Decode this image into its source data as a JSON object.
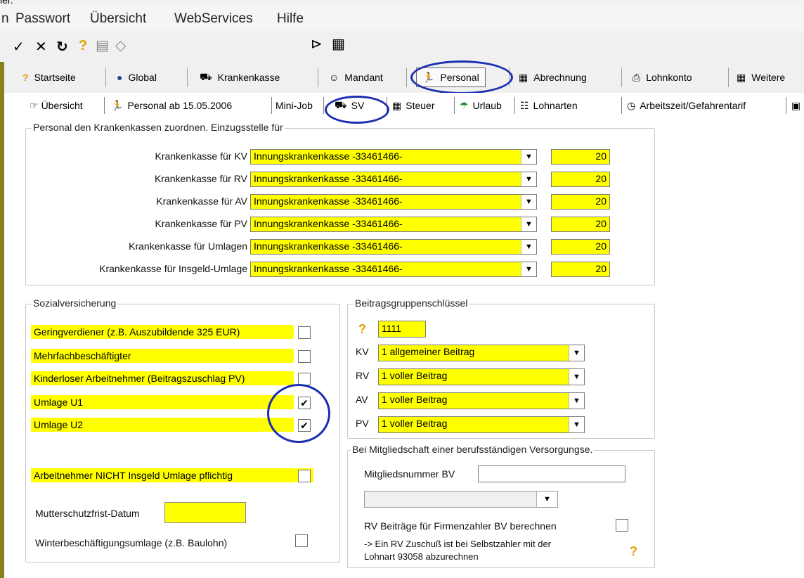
{
  "top_fragment": "ler.",
  "menu": [
    "n",
    "Passwort",
    "Übersicht",
    "WebServices",
    "Hilfe"
  ],
  "toolbar_icons": [
    "check-icon",
    "x-icon",
    "redo-icon",
    "help-icon",
    "document-icon",
    "eraser-icon",
    "folder-open-icon",
    "calendar-icon"
  ],
  "main_nav": [
    {
      "label": "Startseite",
      "icon": "?"
    },
    {
      "label": "Global",
      "icon": "🌍"
    },
    {
      "label": "Krankenkasse",
      "icon": "🚑"
    },
    {
      "label": "Mandant",
      "icon": "👤"
    },
    {
      "label": "Personal",
      "icon": "🏃"
    },
    {
      "label": "Abrechnung",
      "icon": "▦"
    },
    {
      "label": "Lohnkonto",
      "icon": "🖶"
    },
    {
      "label": "Weitere",
      "icon": "▦"
    }
  ],
  "sub_tabs": [
    {
      "label": "Übersicht",
      "icon": "☞"
    },
    {
      "label": "Personal ab 15.05.2006",
      "icon": "🏃"
    },
    {
      "label": "Mini-Job",
      "icon": ""
    },
    {
      "label": "SV",
      "icon": "🚑"
    },
    {
      "label": "Steuer",
      "icon": "▦"
    },
    {
      "label": "Urlaub",
      "icon": "🏖"
    },
    {
      "label": "Lohnarten",
      "icon": "☷"
    },
    {
      "label": "Arbeitszeit/Gefahrentarif",
      "icon": "◷"
    }
  ],
  "kk_group": {
    "legend": "Personal den Krankenkassen zuordnen. Einzugsstelle für",
    "rows": [
      {
        "label": "Krankenkasse für KV",
        "value": "Innungskrankenkasse -33461466-",
        "num": "20"
      },
      {
        "label": "Krankenkasse für RV",
        "value": "Innungskrankenkasse -33461466-",
        "num": "20"
      },
      {
        "label": "Krankenkasse für AV",
        "value": "Innungskrankenkasse -33461466-",
        "num": "20"
      },
      {
        "label": "Krankenkasse für PV",
        "value": "Innungskrankenkasse -33461466-",
        "num": "20"
      },
      {
        "label": "Krankenkasse für Umlagen",
        "value": "Innungskrankenkasse -33461466-",
        "num": "20"
      },
      {
        "label": "Krankenkasse für Insgeld-Umlage",
        "value": "Innungskrankenkasse -33461466-",
        "num": "20"
      }
    ]
  },
  "sv_group": {
    "legend": "Sozialversicherung",
    "items": [
      {
        "label": "Geringverdiener (z.B. Auszubildende 325 EUR)",
        "checked": false
      },
      {
        "label": "Mehrfachbeschäftigter",
        "checked": false
      },
      {
        "label": "Kinderloser Arbeitnehmer (Beitragszuschlag PV)",
        "checked": false
      },
      {
        "label": "Umlage U1",
        "checked": true
      },
      {
        "label": "Umlage U2",
        "checked": true
      }
    ],
    "insgeld_label": "Arbeitnehmer NICHT Insgeld Umlage pflichtig",
    "mutterschutz_label": "Mutterschutzfrist-Datum",
    "mutterschutz_value": "",
    "winter_label": "Winterbeschäftigungsumlage (z.B. Baulohn)"
  },
  "bgs_group": {
    "legend": "Beitragsgruppenschlüssel",
    "code": "1111",
    "rows": [
      {
        "label": "KV",
        "value": "1 allgemeiner Beitrag"
      },
      {
        "label": "RV",
        "value": "1 voller Beitrag"
      },
      {
        "label": "AV",
        "value": "1 voller Beitrag"
      },
      {
        "label": "PV",
        "value": "1 voller Beitrag"
      }
    ]
  },
  "bv_group": {
    "legend": "Bei Mitgliedschaft einer berufsständigen Versorgungse.",
    "member_label": "Mitgliedsnummer BV",
    "member_value": "",
    "select_value": "",
    "rv_label": "RV Beiträge für Firmenzahler BV berechnen",
    "note_line1": "-> Ein RV Zuschuß ist bei Selbstzahler mit der",
    "note_line2": "Lohnart 93058 abzurechnen"
  },
  "colors": {
    "highlight": "#ffff00",
    "annotation": "#1a2fb0",
    "accent": "#8b8020"
  }
}
